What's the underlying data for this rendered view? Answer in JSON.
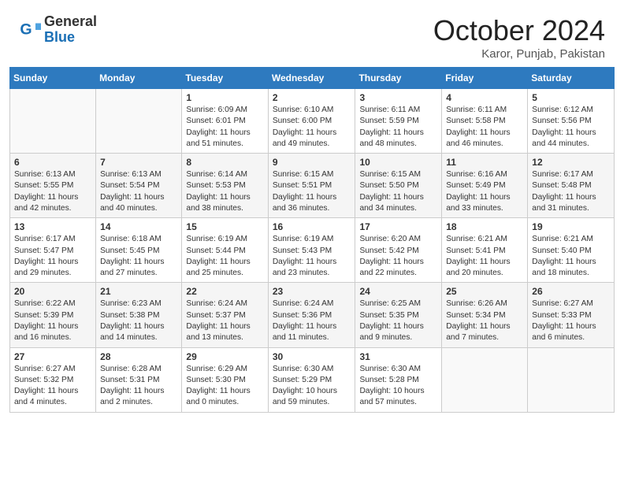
{
  "header": {
    "logo_general": "General",
    "logo_blue": "Blue",
    "month_title": "October 2024",
    "location": "Karor, Punjab, Pakistan"
  },
  "days_of_week": [
    "Sunday",
    "Monday",
    "Tuesday",
    "Wednesday",
    "Thursday",
    "Friday",
    "Saturday"
  ],
  "weeks": [
    [
      {
        "day": "",
        "sunrise": "",
        "sunset": "",
        "daylight": ""
      },
      {
        "day": "",
        "sunrise": "",
        "sunset": "",
        "daylight": ""
      },
      {
        "day": "1",
        "sunrise": "Sunrise: 6:09 AM",
        "sunset": "Sunset: 6:01 PM",
        "daylight": "Daylight: 11 hours and 51 minutes."
      },
      {
        "day": "2",
        "sunrise": "Sunrise: 6:10 AM",
        "sunset": "Sunset: 6:00 PM",
        "daylight": "Daylight: 11 hours and 49 minutes."
      },
      {
        "day": "3",
        "sunrise": "Sunrise: 6:11 AM",
        "sunset": "Sunset: 5:59 PM",
        "daylight": "Daylight: 11 hours and 48 minutes."
      },
      {
        "day": "4",
        "sunrise": "Sunrise: 6:11 AM",
        "sunset": "Sunset: 5:58 PM",
        "daylight": "Daylight: 11 hours and 46 minutes."
      },
      {
        "day": "5",
        "sunrise": "Sunrise: 6:12 AM",
        "sunset": "Sunset: 5:56 PM",
        "daylight": "Daylight: 11 hours and 44 minutes."
      }
    ],
    [
      {
        "day": "6",
        "sunrise": "Sunrise: 6:13 AM",
        "sunset": "Sunset: 5:55 PM",
        "daylight": "Daylight: 11 hours and 42 minutes."
      },
      {
        "day": "7",
        "sunrise": "Sunrise: 6:13 AM",
        "sunset": "Sunset: 5:54 PM",
        "daylight": "Daylight: 11 hours and 40 minutes."
      },
      {
        "day": "8",
        "sunrise": "Sunrise: 6:14 AM",
        "sunset": "Sunset: 5:53 PM",
        "daylight": "Daylight: 11 hours and 38 minutes."
      },
      {
        "day": "9",
        "sunrise": "Sunrise: 6:15 AM",
        "sunset": "Sunset: 5:51 PM",
        "daylight": "Daylight: 11 hours and 36 minutes."
      },
      {
        "day": "10",
        "sunrise": "Sunrise: 6:15 AM",
        "sunset": "Sunset: 5:50 PM",
        "daylight": "Daylight: 11 hours and 34 minutes."
      },
      {
        "day": "11",
        "sunrise": "Sunrise: 6:16 AM",
        "sunset": "Sunset: 5:49 PM",
        "daylight": "Daylight: 11 hours and 33 minutes."
      },
      {
        "day": "12",
        "sunrise": "Sunrise: 6:17 AM",
        "sunset": "Sunset: 5:48 PM",
        "daylight": "Daylight: 11 hours and 31 minutes."
      }
    ],
    [
      {
        "day": "13",
        "sunrise": "Sunrise: 6:17 AM",
        "sunset": "Sunset: 5:47 PM",
        "daylight": "Daylight: 11 hours and 29 minutes."
      },
      {
        "day": "14",
        "sunrise": "Sunrise: 6:18 AM",
        "sunset": "Sunset: 5:45 PM",
        "daylight": "Daylight: 11 hours and 27 minutes."
      },
      {
        "day": "15",
        "sunrise": "Sunrise: 6:19 AM",
        "sunset": "Sunset: 5:44 PM",
        "daylight": "Daylight: 11 hours and 25 minutes."
      },
      {
        "day": "16",
        "sunrise": "Sunrise: 6:19 AM",
        "sunset": "Sunset: 5:43 PM",
        "daylight": "Daylight: 11 hours and 23 minutes."
      },
      {
        "day": "17",
        "sunrise": "Sunrise: 6:20 AM",
        "sunset": "Sunset: 5:42 PM",
        "daylight": "Daylight: 11 hours and 22 minutes."
      },
      {
        "day": "18",
        "sunrise": "Sunrise: 6:21 AM",
        "sunset": "Sunset: 5:41 PM",
        "daylight": "Daylight: 11 hours and 20 minutes."
      },
      {
        "day": "19",
        "sunrise": "Sunrise: 6:21 AM",
        "sunset": "Sunset: 5:40 PM",
        "daylight": "Daylight: 11 hours and 18 minutes."
      }
    ],
    [
      {
        "day": "20",
        "sunrise": "Sunrise: 6:22 AM",
        "sunset": "Sunset: 5:39 PM",
        "daylight": "Daylight: 11 hours and 16 minutes."
      },
      {
        "day": "21",
        "sunrise": "Sunrise: 6:23 AM",
        "sunset": "Sunset: 5:38 PM",
        "daylight": "Daylight: 11 hours and 14 minutes."
      },
      {
        "day": "22",
        "sunrise": "Sunrise: 6:24 AM",
        "sunset": "Sunset: 5:37 PM",
        "daylight": "Daylight: 11 hours and 13 minutes."
      },
      {
        "day": "23",
        "sunrise": "Sunrise: 6:24 AM",
        "sunset": "Sunset: 5:36 PM",
        "daylight": "Daylight: 11 hours and 11 minutes."
      },
      {
        "day": "24",
        "sunrise": "Sunrise: 6:25 AM",
        "sunset": "Sunset: 5:35 PM",
        "daylight": "Daylight: 11 hours and 9 minutes."
      },
      {
        "day": "25",
        "sunrise": "Sunrise: 6:26 AM",
        "sunset": "Sunset: 5:34 PM",
        "daylight": "Daylight: 11 hours and 7 minutes."
      },
      {
        "day": "26",
        "sunrise": "Sunrise: 6:27 AM",
        "sunset": "Sunset: 5:33 PM",
        "daylight": "Daylight: 11 hours and 6 minutes."
      }
    ],
    [
      {
        "day": "27",
        "sunrise": "Sunrise: 6:27 AM",
        "sunset": "Sunset: 5:32 PM",
        "daylight": "Daylight: 11 hours and 4 minutes."
      },
      {
        "day": "28",
        "sunrise": "Sunrise: 6:28 AM",
        "sunset": "Sunset: 5:31 PM",
        "daylight": "Daylight: 11 hours and 2 minutes."
      },
      {
        "day": "29",
        "sunrise": "Sunrise: 6:29 AM",
        "sunset": "Sunset: 5:30 PM",
        "daylight": "Daylight: 11 hours and 0 minutes."
      },
      {
        "day": "30",
        "sunrise": "Sunrise: 6:30 AM",
        "sunset": "Sunset: 5:29 PM",
        "daylight": "Daylight: 10 hours and 59 minutes."
      },
      {
        "day": "31",
        "sunrise": "Sunrise: 6:30 AM",
        "sunset": "Sunset: 5:28 PM",
        "daylight": "Daylight: 10 hours and 57 minutes."
      },
      {
        "day": "",
        "sunrise": "",
        "sunset": "",
        "daylight": ""
      },
      {
        "day": "",
        "sunrise": "",
        "sunset": "",
        "daylight": ""
      }
    ]
  ]
}
